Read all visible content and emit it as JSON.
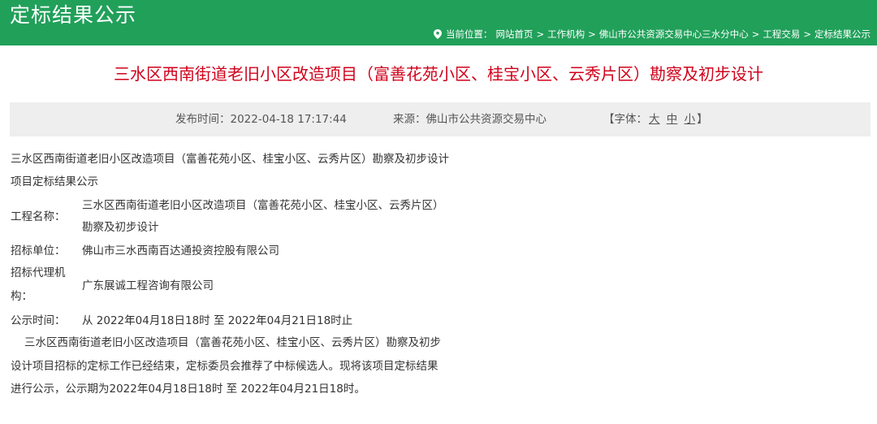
{
  "header": {
    "site_title": "定标结果公示",
    "breadcrumb": {
      "prefix": "当前位置：",
      "items": [
        "网站首页",
        "工作机构",
        "佛山市公共资源交易中心三水分中心",
        "工程交易",
        "定标结果公示"
      ],
      "separator": ">"
    }
  },
  "article": {
    "title": "三水区西南街道老旧小区改造项目（富善花苑小区、桂宝小区、云秀片区）勘察及初步设计",
    "meta": {
      "publish_time": "发布时间：2022-04-18 17:17:44",
      "source": "来源：佛山市公共资源交易中心",
      "font_open": "【字体：",
      "font_sizes": [
        "大",
        "中",
        "小"
      ],
      "font_close": "】"
    },
    "body": {
      "heading_line1": "三水区西南街道老旧小区改造项目（富善花苑小区、桂宝小区、云秀片区）勘察及初步设计",
      "heading_line2": "项目定标结果公示",
      "project_name_label": "工程名称：",
      "project_name_line1": "三水区西南街道老旧小区改造项目（富善花苑小区、桂宝小区、云秀片区）",
      "project_name_line2": "勘察及初步设计",
      "tenderer_label": "招标单位：",
      "tenderer_value": "佛山市三水西南百达通投资控股有限公司",
      "agency_label_line1": "招标代理机",
      "agency_label_line2": "构：",
      "agency_value": "广东展诚工程咨询有限公司",
      "notice_time_label": "公示时间：",
      "notice_time_value": "从  2022年04月18日18时 至 2022年04月21日18时止",
      "paragraph_line1": "三水区西南街道老旧小区改造项目（富善花苑小区、桂宝小区、云秀片区）勘察及初步",
      "paragraph_line2": "设计项目招标的定标工作已经结束，定标委员会推荐了中标候选人。现将该项目定标结果",
      "paragraph_line3": "进行公示，公示期为2022年04月18日18时 至 2022年04月21日18时。"
    }
  },
  "colors": {
    "header_bg": "#21a05a",
    "title_red": "#d0021b",
    "meta_bg": "#eeeeee"
  },
  "icons": {
    "breadcrumb": "location-pin-icon"
  }
}
